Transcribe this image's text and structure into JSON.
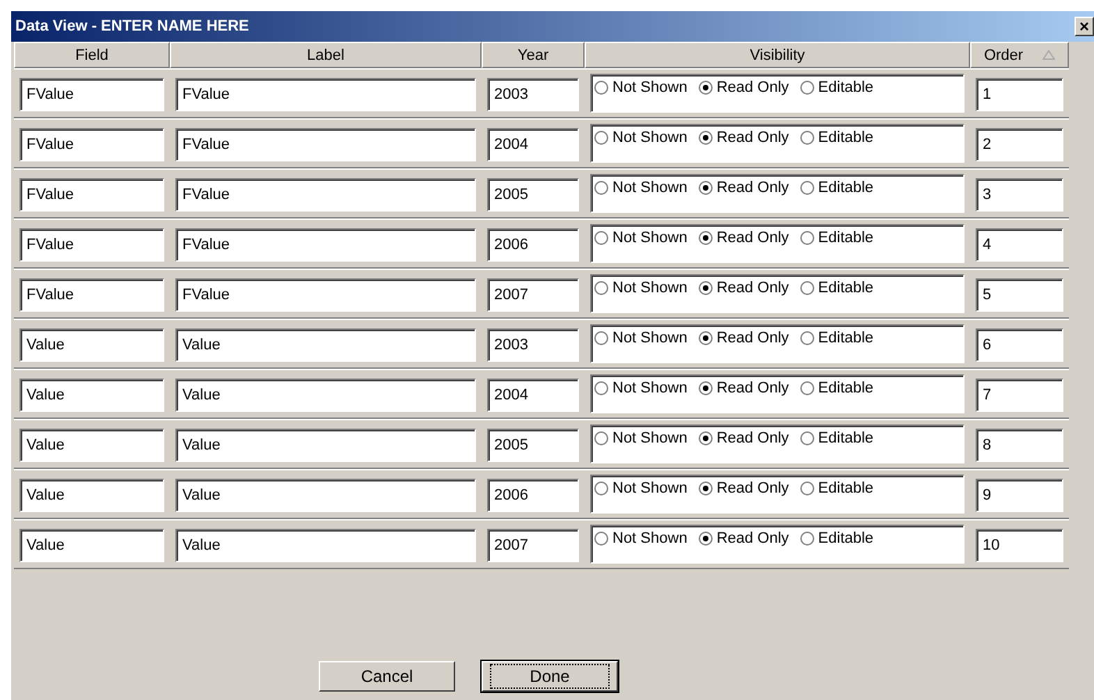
{
  "window": {
    "title": "Data View  - ENTER NAME HERE",
    "close": "×"
  },
  "columns": [
    {
      "label": "Field",
      "sorted": false
    },
    {
      "label": "Label",
      "sorted": false
    },
    {
      "label": "Year",
      "sorted": false
    },
    {
      "label": "Visibility",
      "sorted": false
    },
    {
      "label": "Order",
      "sorted": true
    }
  ],
  "rows": [
    {
      "field": "FValue",
      "label": "FValue",
      "year": "2003",
      "order": "1",
      "visibility": [
        {
          "label": "Not Shown",
          "selected": false
        },
        {
          "label": "Read Only",
          "selected": true
        },
        {
          "label": "Editable",
          "selected": false
        }
      ]
    },
    {
      "field": "FValue",
      "label": "FValue",
      "year": "2004",
      "order": "2",
      "visibility": [
        {
          "label": "Not Shown",
          "selected": false
        },
        {
          "label": "Read Only",
          "selected": true
        },
        {
          "label": "Editable",
          "selected": false
        }
      ]
    },
    {
      "field": "FValue",
      "label": "FValue",
      "year": "2005",
      "order": "3",
      "visibility": [
        {
          "label": "Not Shown",
          "selected": false
        },
        {
          "label": "Read Only",
          "selected": true
        },
        {
          "label": "Editable",
          "selected": false
        }
      ]
    },
    {
      "field": "FValue",
      "label": "FValue",
      "year": "2006",
      "order": "4",
      "visibility": [
        {
          "label": "Not Shown",
          "selected": false
        },
        {
          "label": "Read Only",
          "selected": true
        },
        {
          "label": "Editable",
          "selected": false
        }
      ]
    },
    {
      "field": "FValue",
      "label": "FValue",
      "year": "2007",
      "order": "5",
      "visibility": [
        {
          "label": "Not Shown",
          "selected": false
        },
        {
          "label": "Read Only",
          "selected": true
        },
        {
          "label": "Editable",
          "selected": false
        }
      ]
    },
    {
      "field": "Value",
      "label": "Value",
      "year": "2003",
      "order": "6",
      "visibility": [
        {
          "label": "Not Shown",
          "selected": false
        },
        {
          "label": "Read Only",
          "selected": true
        },
        {
          "label": "Editable",
          "selected": false
        }
      ]
    },
    {
      "field": "Value",
      "label": "Value",
      "year": "2004",
      "order": "7",
      "visibility": [
        {
          "label": "Not Shown",
          "selected": false
        },
        {
          "label": "Read Only",
          "selected": true
        },
        {
          "label": "Editable",
          "selected": false
        }
      ]
    },
    {
      "field": "Value",
      "label": "Value",
      "year": "2005",
      "order": "8",
      "visibility": [
        {
          "label": "Not Shown",
          "selected": false
        },
        {
          "label": "Read Only",
          "selected": true
        },
        {
          "label": "Editable",
          "selected": false
        }
      ]
    },
    {
      "field": "Value",
      "label": "Value",
      "year": "2006",
      "order": "9",
      "visibility": [
        {
          "label": "Not Shown",
          "selected": false
        },
        {
          "label": "Read Only",
          "selected": true
        },
        {
          "label": "Editable",
          "selected": false
        }
      ]
    },
    {
      "field": "Value",
      "label": "Value",
      "year": "2007",
      "order": "10",
      "visibility": [
        {
          "label": "Not Shown",
          "selected": false
        },
        {
          "label": "Read Only",
          "selected": true
        },
        {
          "label": "Editable",
          "selected": false
        }
      ]
    }
  ],
  "buttons": [
    {
      "label": "Cancel",
      "focused": false
    },
    {
      "label": "Done",
      "focused": true
    }
  ]
}
